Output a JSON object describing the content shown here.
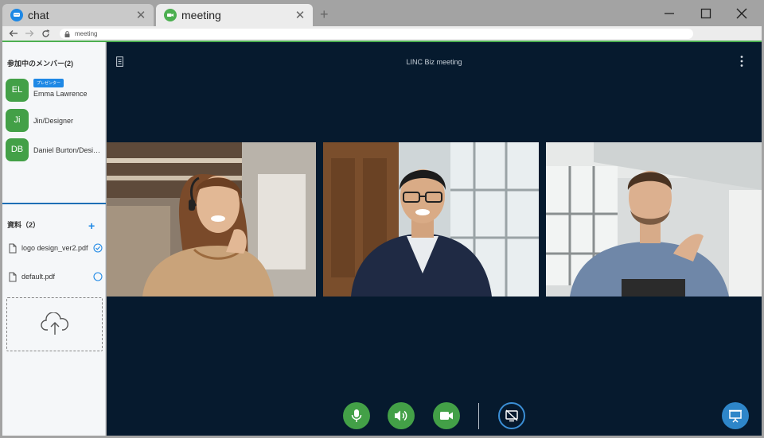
{
  "browser": {
    "tabs": [
      {
        "label": "chat",
        "icon": "chat-icon",
        "active": false
      },
      {
        "label": "meeting",
        "icon": "video-icon",
        "active": true
      }
    ],
    "url": "meeting"
  },
  "sidebar": {
    "members_title": "参加中のメンバー(2)",
    "members": [
      {
        "initials": "EL",
        "name": "Emma Lawrence",
        "badge": "プレゼンター"
      },
      {
        "initials": "Ji",
        "name": "Jin/Designer"
      },
      {
        "initials": "DB",
        "name": "Daniel Burton/Designer"
      }
    ],
    "docs_title": "資料（2）",
    "docs": [
      {
        "name": "logo design_ver2.pdf",
        "status": "checked"
      },
      {
        "name": "default.pdf",
        "status": "unchecked"
      }
    ]
  },
  "main": {
    "title": "LINC Biz meeting"
  },
  "colors": {
    "accent_green": "#43a047",
    "accent_blue": "#1e88e5",
    "meeting_bg": "#061a2e"
  }
}
